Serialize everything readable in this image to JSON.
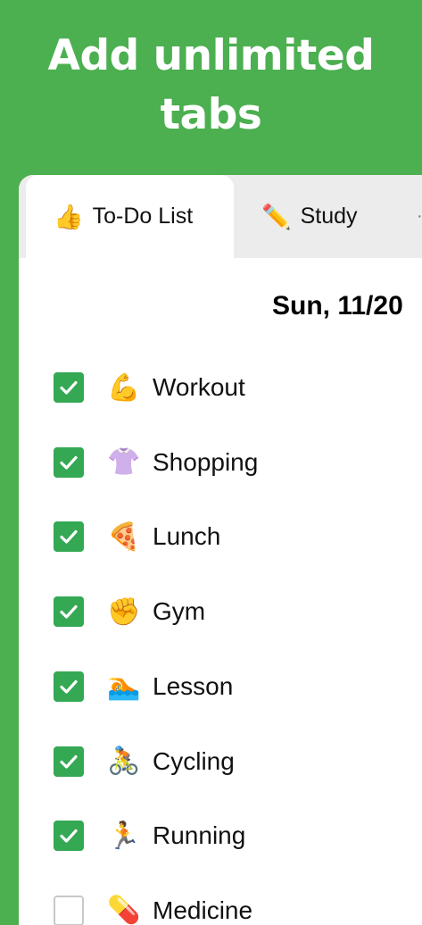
{
  "promo": {
    "line1": "Add unlimited",
    "line2": "tabs"
  },
  "tabs": [
    {
      "emoji": "👍",
      "label": "To-Do List",
      "active": true
    },
    {
      "emoji": "✏️",
      "label": "Study",
      "active": false
    }
  ],
  "date_header": "Sun, 11/20",
  "tasks": [
    {
      "emoji": "💪",
      "label": "Workout",
      "done": true
    },
    {
      "emoji": "👚",
      "label": "Shopping",
      "done": true
    },
    {
      "emoji": "🍕",
      "label": "Lunch",
      "done": true
    },
    {
      "emoji": "✊",
      "label": "Gym",
      "done": true
    },
    {
      "emoji": "🏊",
      "label": "Lesson",
      "done": true
    },
    {
      "emoji": "🚴",
      "label": "Cycling",
      "done": true
    },
    {
      "emoji": "🏃",
      "label": "Running",
      "done": true
    },
    {
      "emoji": "💊",
      "label": "Medicine",
      "done": false
    }
  ],
  "colors": {
    "background": "#4caf50",
    "checkbox": "#34a853",
    "tab_inactive": "#ececec"
  }
}
